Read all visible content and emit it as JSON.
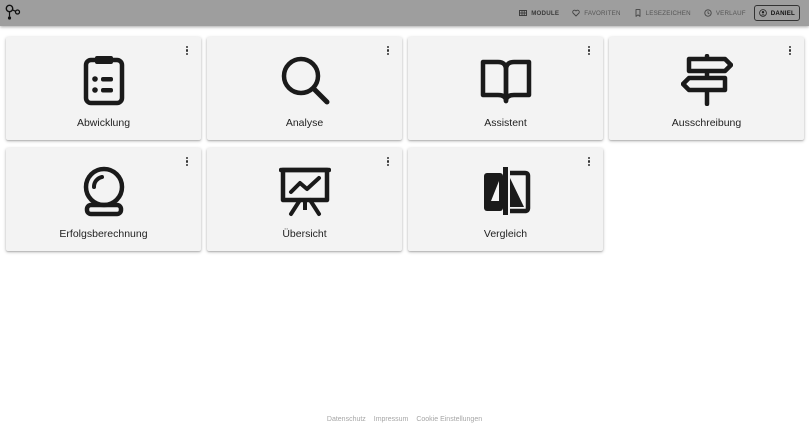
{
  "header": {
    "nav": {
      "module": "MODULE",
      "favoriten": "FAVORITEN",
      "lesezeichen": "LESEZEICHEN",
      "verlauf": "VERLAUF",
      "user": "DANIEL"
    }
  },
  "tiles": [
    {
      "label": "Abwicklung",
      "icon": "clipboard-list-icon"
    },
    {
      "label": "Analyse",
      "icon": "magnifier-icon"
    },
    {
      "label": "Assistent",
      "icon": "open-book-icon"
    },
    {
      "label": "Ausschreibung",
      "icon": "signpost-icon"
    },
    {
      "label": "Erfolgsberechnung",
      "icon": "crystal-ball-icon"
    },
    {
      "label": "Übersicht",
      "icon": "presentation-chart-icon"
    },
    {
      "label": "Vergleich",
      "icon": "compare-icon"
    }
  ],
  "footer": {
    "datenschutz": "Datenschutz",
    "impressum": "Impressum",
    "cookie": "Cookie Einstellungen"
  },
  "colors": {
    "header_bg": "#9e9e9e",
    "card_bg": "#f3f3f3",
    "icon": "#1a1a1a",
    "footer_text": "#a6a6a6"
  }
}
